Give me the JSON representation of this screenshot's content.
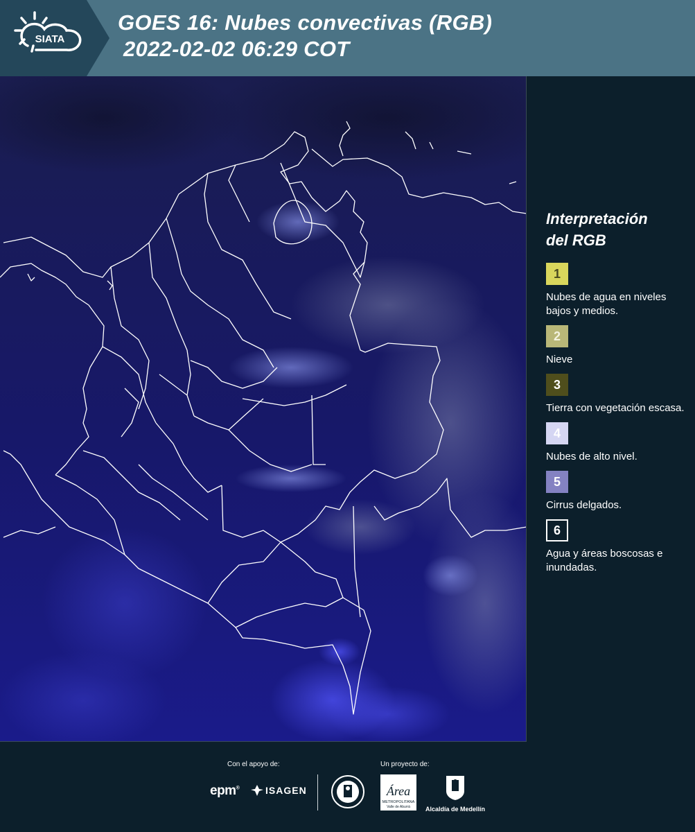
{
  "header": {
    "logo_text": "SIATA",
    "title_line1": "GOES 16: Nubes convectivas (RGB)",
    "title_line2": "2022-02-02 06:29 COT"
  },
  "legend": {
    "title_line1": "Interpretación",
    "title_line2": "del RGB",
    "items": [
      {
        "number": "1",
        "label": "Nubes de agua en niveles bajos y medios.",
        "color": "#d9d65c",
        "text_color": "#4a4a20"
      },
      {
        "number": "2",
        "label": "Nieve",
        "color": "#b9b778",
        "text_color": "#f3f3e0"
      },
      {
        "number": "3",
        "label": "Tierra con vegetación escasa.",
        "color": "#4f4e1c",
        "text_color": "#ffffff"
      },
      {
        "number": "4",
        "label": "Nubes de alto nivel.",
        "color": "#d5d6f3",
        "text_color": "#ffffff"
      },
      {
        "number": "5",
        "label": "Cirrus delgados.",
        "color": "#8482c2",
        "text_color": "#ffffff"
      },
      {
        "number": "6",
        "label": "Agua y áreas boscosas e inundadas.",
        "color": "#0c1f2b",
        "text_color": "#ffffff"
      }
    ]
  },
  "footer": {
    "support_label": "Con el apoyo de:",
    "project_label": "Un proyecto de:",
    "epm_text": "epm",
    "isagen_text": "ISAGEN",
    "area_text": "Área",
    "area_subtext": "METROPOLITANA",
    "area_subtext2": "Valle de Aburrá",
    "alcaldia_text": "Alcaldía de Medellín"
  },
  "colors": {
    "header_bg": "#4b7385",
    "page_bg": "#0c1f2b",
    "map_bg": "#16184f",
    "border_lines": "#ffffff"
  }
}
